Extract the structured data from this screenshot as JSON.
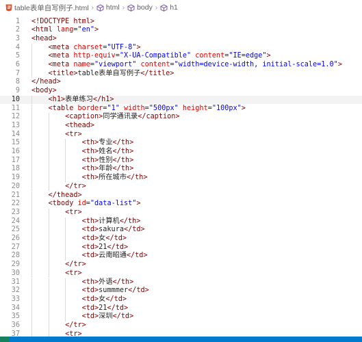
{
  "breadcrumb": {
    "file": "table表单自写例子.html",
    "items": [
      "html",
      "body",
      "h1"
    ]
  },
  "active_line": 10,
  "colors": {
    "tag": "#800000",
    "attribute": "#e50000",
    "string": "#0000ff",
    "text": "#1f1f1f",
    "line_number": "#8a8a8a",
    "statusbar": "#007acc"
  },
  "lines": [
    {
      "n": "1",
      "parts": [
        [
          "p",
          "<!DOCTYPE html>"
        ]
      ]
    },
    {
      "n": "2",
      "parts": [
        [
          "t",
          "<html "
        ],
        [
          "a",
          "lang"
        ],
        [
          "x",
          "="
        ],
        [
          "s",
          "\"en\""
        ],
        [
          "t",
          ">"
        ]
      ]
    },
    {
      "n": "3",
      "parts": [
        [
          "t",
          "<head>"
        ]
      ]
    },
    {
      "n": "4",
      "parts": [
        [
          "x",
          "    "
        ],
        [
          "t",
          "<meta "
        ],
        [
          "a",
          "charset"
        ],
        [
          "x",
          "="
        ],
        [
          "s",
          "\"UTF-8\""
        ],
        [
          "t",
          ">"
        ]
      ]
    },
    {
      "n": "5",
      "parts": [
        [
          "x",
          "    "
        ],
        [
          "t",
          "<meta "
        ],
        [
          "a",
          "http-equiv"
        ],
        [
          "x",
          "="
        ],
        [
          "s",
          "\"X-UA-Compatible\""
        ],
        [
          "x",
          " "
        ],
        [
          "a",
          "content"
        ],
        [
          "x",
          "="
        ],
        [
          "s",
          "\"IE=edge\""
        ],
        [
          "t",
          ">"
        ]
      ]
    },
    {
      "n": "6",
      "parts": [
        [
          "x",
          "    "
        ],
        [
          "t",
          "<meta "
        ],
        [
          "a",
          "name"
        ],
        [
          "x",
          "="
        ],
        [
          "s",
          "\"viewport\""
        ],
        [
          "x",
          " "
        ],
        [
          "a",
          "content"
        ],
        [
          "x",
          "="
        ],
        [
          "s",
          "\"width=device-width, initial-scale=1.0\""
        ],
        [
          "t",
          ">"
        ]
      ]
    },
    {
      "n": "7",
      "parts": [
        [
          "x",
          "    "
        ],
        [
          "t",
          "<title>"
        ],
        [
          "x",
          "table表单自写例子"
        ],
        [
          "t",
          "</title>"
        ]
      ]
    },
    {
      "n": "8",
      "parts": [
        [
          "t",
          "</head>"
        ]
      ]
    },
    {
      "n": "9",
      "parts": [
        [
          "t",
          "<body>"
        ]
      ]
    },
    {
      "n": "10",
      "parts": [
        [
          "x",
          "    "
        ],
        [
          "t",
          "<h1>"
        ],
        [
          "x",
          "表单练习"
        ],
        [
          "t",
          "</h1>"
        ]
      ]
    },
    {
      "n": "11",
      "parts": [
        [
          "x",
          "    "
        ],
        [
          "t",
          "<table "
        ],
        [
          "a",
          "border"
        ],
        [
          "x",
          "="
        ],
        [
          "s",
          "\"1\""
        ],
        [
          "x",
          " "
        ],
        [
          "a",
          "width"
        ],
        [
          "x",
          "="
        ],
        [
          "s",
          "\"500px\""
        ],
        [
          "x",
          " "
        ],
        [
          "a",
          "height"
        ],
        [
          "x",
          "="
        ],
        [
          "s",
          "\"100px\""
        ],
        [
          "t",
          ">"
        ]
      ]
    },
    {
      "n": "12",
      "parts": [
        [
          "x",
          "        "
        ],
        [
          "t",
          "<caption>"
        ],
        [
          "x",
          "同学通讯录"
        ],
        [
          "t",
          "</caption>"
        ]
      ]
    },
    {
      "n": "13",
      "parts": [
        [
          "x",
          "        "
        ],
        [
          "t",
          "<thead>"
        ]
      ]
    },
    {
      "n": "14",
      "parts": [
        [
          "x",
          "        "
        ],
        [
          "t",
          "<tr>"
        ]
      ]
    },
    {
      "n": "15",
      "parts": [
        [
          "x",
          "            "
        ],
        [
          "t",
          "<th>"
        ],
        [
          "x",
          "专业"
        ],
        [
          "t",
          "</th>"
        ]
      ]
    },
    {
      "n": "16",
      "parts": [
        [
          "x",
          "            "
        ],
        [
          "t",
          "<th>"
        ],
        [
          "x",
          "姓名"
        ],
        [
          "t",
          "</th>"
        ]
      ]
    },
    {
      "n": "17",
      "parts": [
        [
          "x",
          "            "
        ],
        [
          "t",
          "<th>"
        ],
        [
          "x",
          "性别"
        ],
        [
          "t",
          "</th>"
        ]
      ]
    },
    {
      "n": "18",
      "parts": [
        [
          "x",
          "            "
        ],
        [
          "t",
          "<th>"
        ],
        [
          "x",
          "年龄"
        ],
        [
          "t",
          "</th>"
        ]
      ]
    },
    {
      "n": "19",
      "parts": [
        [
          "x",
          "            "
        ],
        [
          "t",
          "<th>"
        ],
        [
          "x",
          "所在城市"
        ],
        [
          "t",
          "</th>"
        ]
      ]
    },
    {
      "n": "20",
      "parts": [
        [
          "x",
          "        "
        ],
        [
          "t",
          "</tr>"
        ]
      ]
    },
    {
      "n": "21",
      "parts": [
        [
          "x",
          "    "
        ],
        [
          "t",
          "</thead>"
        ]
      ]
    },
    {
      "n": "22",
      "parts": [
        [
          "x",
          "    "
        ],
        [
          "t",
          "<tbody "
        ],
        [
          "a",
          "id"
        ],
        [
          "x",
          "="
        ],
        [
          "s",
          "\"data-list\""
        ],
        [
          "t",
          ">"
        ]
      ]
    },
    {
      "n": "23",
      "parts": [
        [
          "x",
          "        "
        ],
        [
          "t",
          "<tr>"
        ]
      ]
    },
    {
      "n": "24",
      "parts": [
        [
          "x",
          "            "
        ],
        [
          "t",
          "<th>"
        ],
        [
          "x",
          "计算机"
        ],
        [
          "t",
          "</th>"
        ]
      ]
    },
    {
      "n": "25",
      "parts": [
        [
          "x",
          "            "
        ],
        [
          "t",
          "<td>"
        ],
        [
          "x",
          "sakura"
        ],
        [
          "t",
          "</td>"
        ]
      ]
    },
    {
      "n": "26",
      "parts": [
        [
          "x",
          "            "
        ],
        [
          "t",
          "<td>"
        ],
        [
          "x",
          "女"
        ],
        [
          "t",
          "</td>"
        ]
      ]
    },
    {
      "n": "27",
      "parts": [
        [
          "x",
          "            "
        ],
        [
          "t",
          "<td>"
        ],
        [
          "x",
          "21"
        ],
        [
          "t",
          "</td>"
        ]
      ]
    },
    {
      "n": "28",
      "parts": [
        [
          "x",
          "            "
        ],
        [
          "t",
          "<td>"
        ],
        [
          "x",
          "云南昭通"
        ],
        [
          "t",
          "</td>"
        ]
      ]
    },
    {
      "n": "29",
      "parts": [
        [
          "x",
          "        "
        ],
        [
          "t",
          "</tr>"
        ]
      ]
    },
    {
      "n": "30",
      "parts": [
        [
          "x",
          "        "
        ],
        [
          "t",
          "<tr>"
        ]
      ]
    },
    {
      "n": "31",
      "parts": [
        [
          "x",
          "            "
        ],
        [
          "t",
          "<th>"
        ],
        [
          "x",
          "外语"
        ],
        [
          "t",
          "</th>"
        ]
      ]
    },
    {
      "n": "32",
      "parts": [
        [
          "x",
          "            "
        ],
        [
          "t",
          "<td>"
        ],
        [
          "x",
          "summmer"
        ],
        [
          "t",
          "</td>"
        ]
      ]
    },
    {
      "n": "33",
      "parts": [
        [
          "x",
          "            "
        ],
        [
          "t",
          "<td>"
        ],
        [
          "x",
          "女"
        ],
        [
          "t",
          "</td>"
        ]
      ]
    },
    {
      "n": "34",
      "parts": [
        [
          "x",
          "            "
        ],
        [
          "t",
          "<td>"
        ],
        [
          "x",
          "21"
        ],
        [
          "t",
          "</td>"
        ]
      ]
    },
    {
      "n": "35",
      "parts": [
        [
          "x",
          "            "
        ],
        [
          "t",
          "<td>"
        ],
        [
          "x",
          "深圳"
        ],
        [
          "t",
          "</td>"
        ]
      ]
    },
    {
      "n": "36",
      "parts": [
        [
          "x",
          "        "
        ],
        [
          "t",
          "</tr>"
        ]
      ]
    },
    {
      "n": "37",
      "parts": [
        [
          "x",
          "        "
        ],
        [
          "t",
          "<tr>"
        ]
      ]
    }
  ]
}
